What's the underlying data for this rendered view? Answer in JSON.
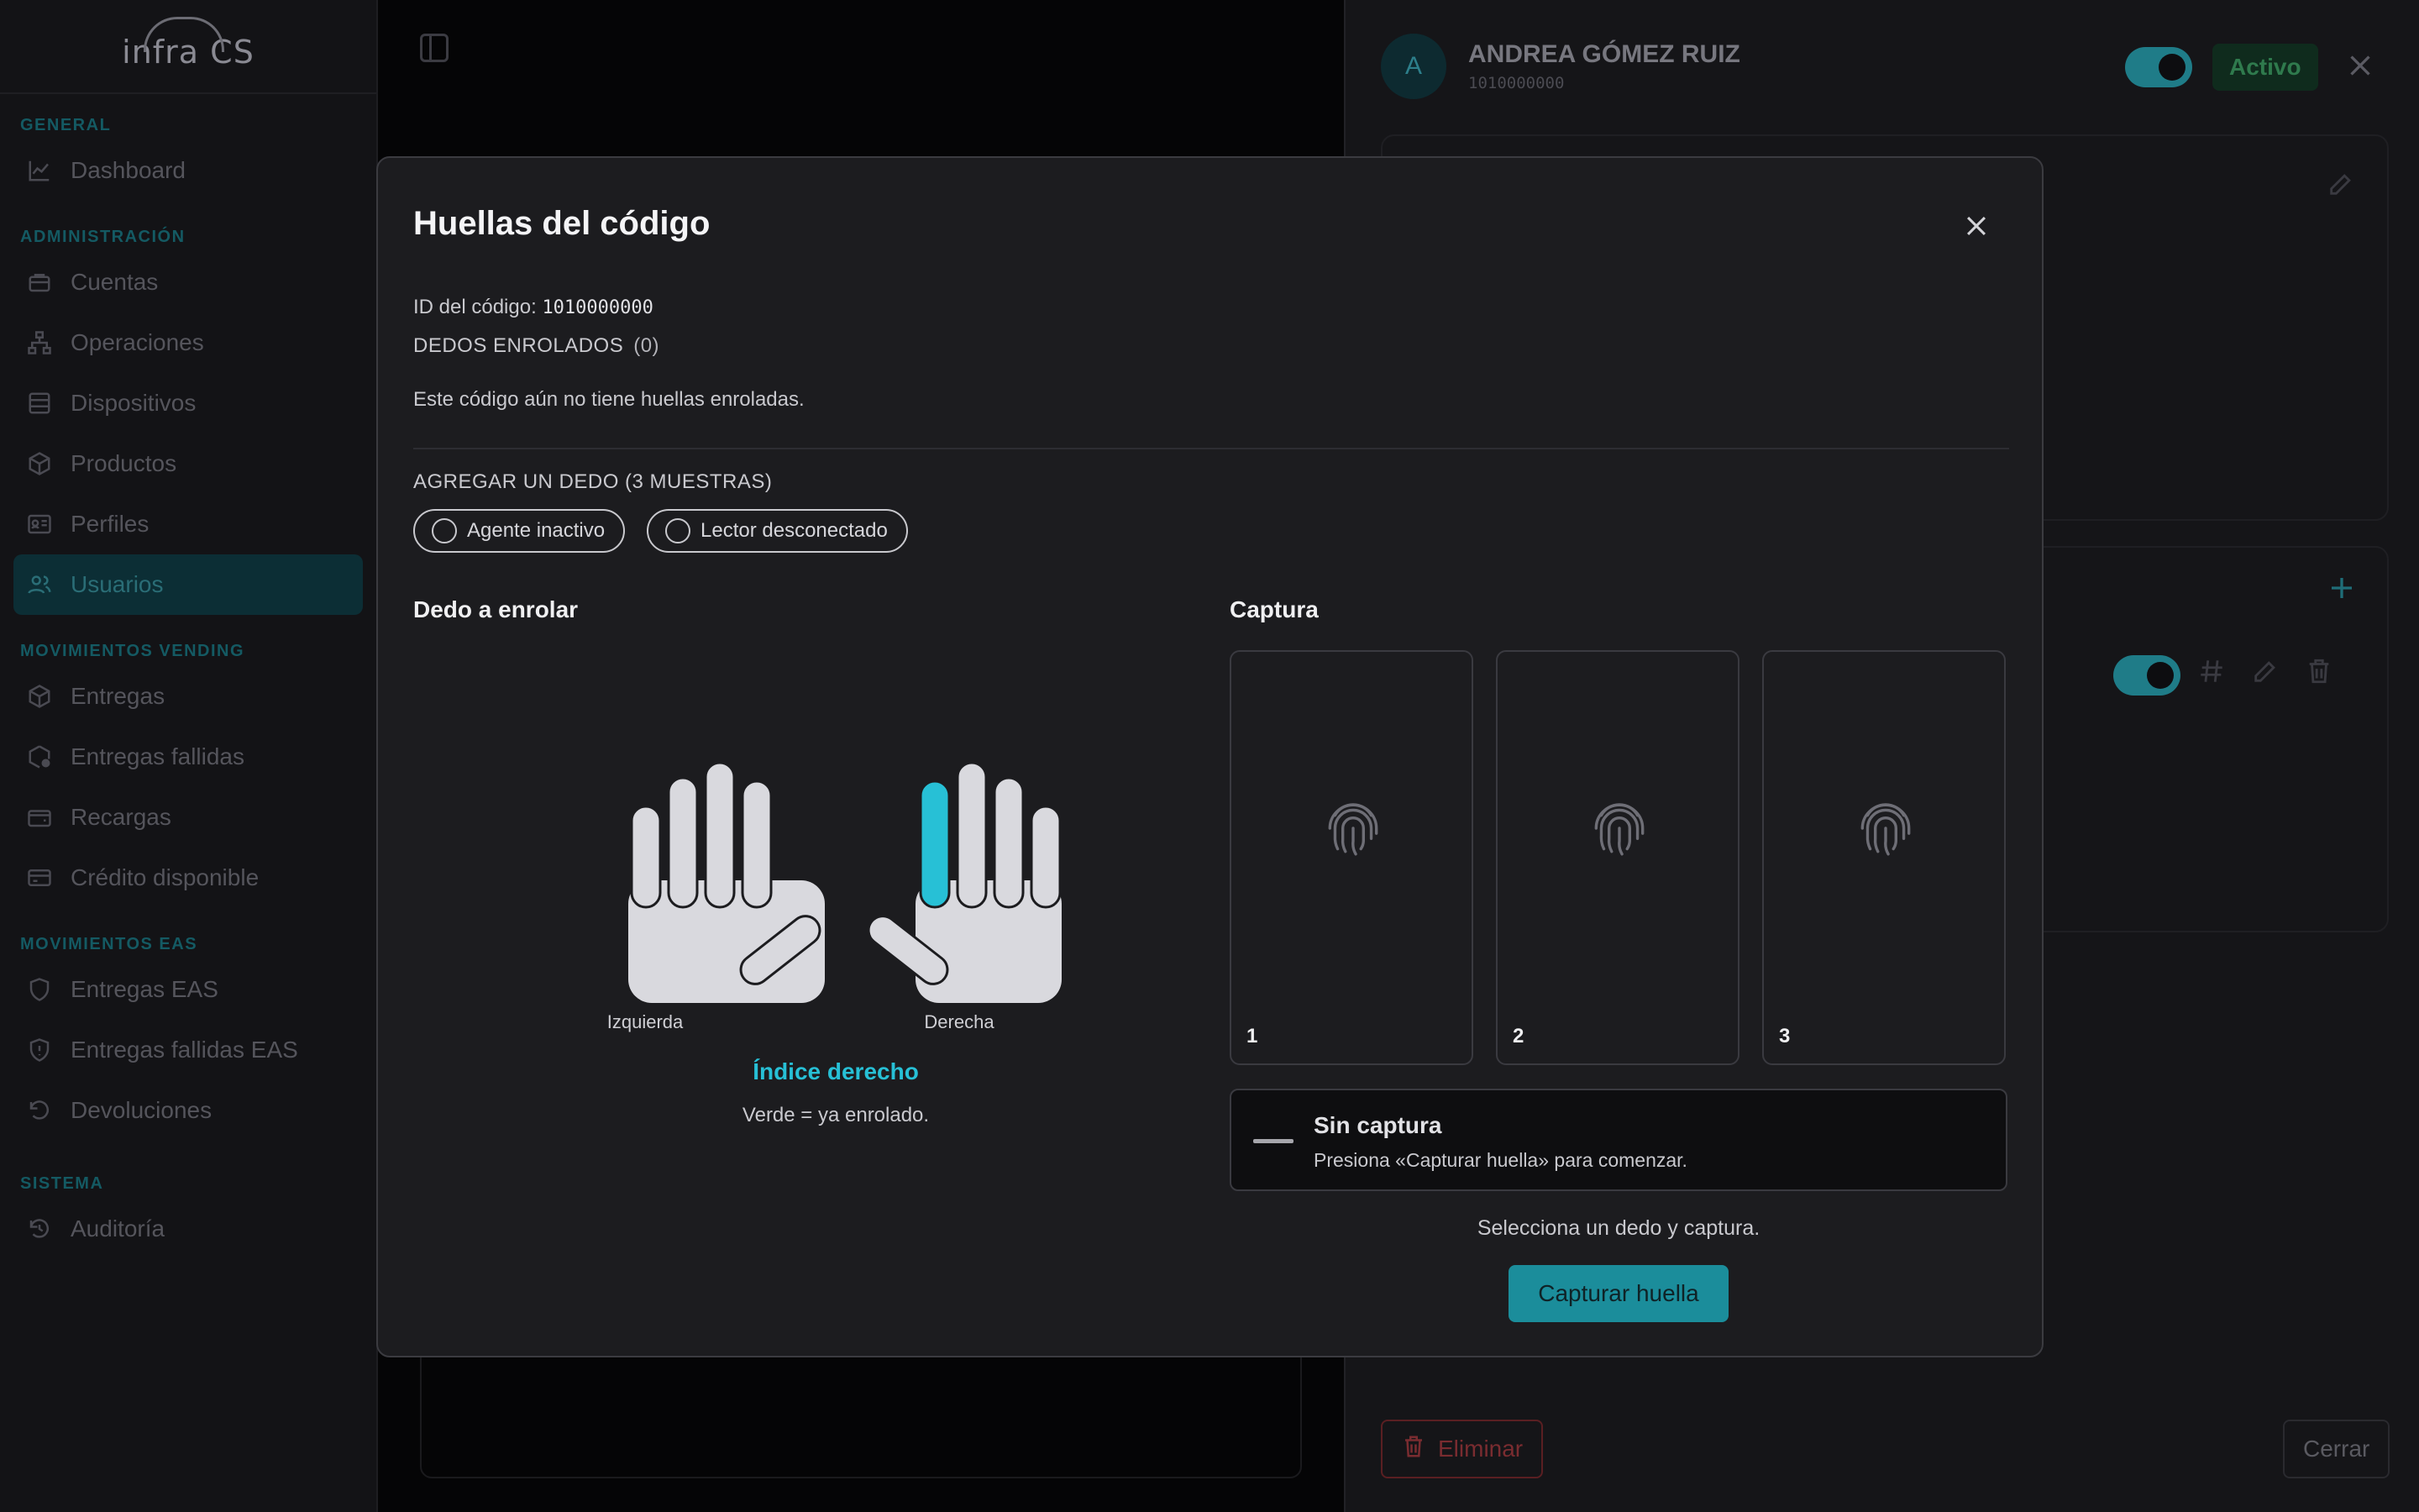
{
  "sidebar": {
    "logo": "infra CS",
    "sections": [
      {
        "title": "GENERAL",
        "items": [
          {
            "label": "Dashboard",
            "icon": "chart-line-icon"
          }
        ]
      },
      {
        "title": "ADMINISTRACIÓN",
        "items": [
          {
            "label": "Cuentas",
            "icon": "briefcase-icon"
          },
          {
            "label": "Operaciones",
            "icon": "org-chart-icon"
          },
          {
            "label": "Dispositivos",
            "icon": "server-icon"
          },
          {
            "label": "Productos",
            "icon": "box-icon"
          },
          {
            "label": "Perfiles",
            "icon": "id-card-icon"
          },
          {
            "label": "Usuarios",
            "icon": "users-icon",
            "active": true
          }
        ]
      },
      {
        "title": "MOVIMIENTOS VENDING",
        "items": [
          {
            "label": "Entregas",
            "icon": "package-icon"
          },
          {
            "label": "Entregas fallidas",
            "icon": "package-alert-icon"
          },
          {
            "label": "Recargas",
            "icon": "wallet-icon"
          },
          {
            "label": "Crédito disponible",
            "icon": "credit-card-icon"
          }
        ]
      },
      {
        "title": "MOVIMIENTOS EAS",
        "items": [
          {
            "label": "Entregas EAS",
            "icon": "shield-icon"
          },
          {
            "label": "Entregas fallidas EAS",
            "icon": "shield-alert-icon"
          },
          {
            "label": "Devoluciones",
            "icon": "undo-icon"
          }
        ]
      },
      {
        "title": "SISTEMA",
        "items": [
          {
            "label": "Auditoría",
            "icon": "history-icon"
          }
        ]
      }
    ]
  },
  "drawer": {
    "avatar_letter": "A",
    "user_name": "ANDREA GÓMEZ RUIZ",
    "user_code": "1010000000",
    "status": "Activo",
    "delete_label": "Eliminar",
    "close_label": "Cerrar"
  },
  "modal": {
    "title": "Huellas del código",
    "code_label": "ID del código:",
    "code_value": "1010000000",
    "enrolled_label": "DEDOS ENROLADOS",
    "enrolled_count": "(0)",
    "empty_message": "Este código aún no tiene huellas enroladas.",
    "add_label": "AGREGAR UN DEDO (3 MUESTRAS)",
    "agent_status": "Agente inactivo",
    "reader_status": "Lector desconectado",
    "finger_section": "Dedo a enrolar",
    "left_hand": "Izquierda",
    "right_hand": "Derecha",
    "selected_finger": "Índice derecho",
    "legend": "Verde = ya enrolado.",
    "capture_section": "Captura",
    "samples": [
      "1",
      "2",
      "3"
    ],
    "status_title": "Sin captura",
    "status_message": "Presiona «Capturar huella» para comenzar.",
    "select_hint": "Selecciona un dedo y captura.",
    "capture_button": "Capturar huella"
  },
  "colors": {
    "accent": "#27c0d6",
    "button": "#1b8d9b",
    "selected_finger": "#27c0d6",
    "finger": "#d9d9de"
  }
}
